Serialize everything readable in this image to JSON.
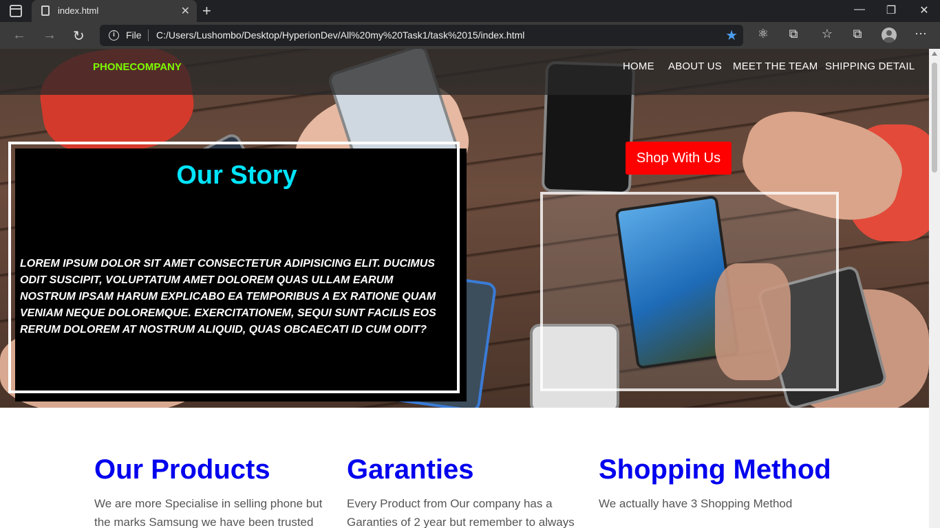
{
  "browser": {
    "tab_title": "index.html",
    "file_label": "File",
    "url": "C:/Users/Lushombo/Desktop/HyperionDev/All%20my%20Task1/task%2015/index.html"
  },
  "site": {
    "brand": "PHONECOMPANY",
    "nav": [
      "HOME",
      "ABOUT US",
      "MEET THE TEAM",
      "SHIPPING DETAIL"
    ],
    "story_title": "Our Story",
    "story_text": "LOREM IPSUM DOLOR SIT AMET CONSECTETUR ADIPISICING ELIT. DUCIMUS ODIT SUSCIPIT, VOLUPTATUM AMET DOLOREM QUAS ULLAM EARUM NOSTRUM IPSAM HARUM EXPLICABO EA TEMPORIBUS A EX RATIONE QUAM VENIAM NEQUE DOLOREMQUE. EXERCITATIONEM, SEQUI SUNT FACILIS EOS RERUM DOLOREM AT NOSTRUM ALIQUID, QUAS OBCAECATI ID CUM ODIT?",
    "shop_button": "Shop With Us",
    "columns": [
      {
        "title": "Our Products",
        "text": "We are more Specialise in selling phone but the marks Samsung we have been trusted by"
      },
      {
        "title": "Garanties",
        "text": "Every Product from Our company has a Garanties of 2 year but remember to always"
      },
      {
        "title": "Shopping Method",
        "text": "We actually have 3 Shopping Method"
      }
    ]
  },
  "colors": {
    "brand": "#7cfc00",
    "story_title": "#00e5ff",
    "shop_button": "#ff0000",
    "column_title": "#0000ee"
  }
}
